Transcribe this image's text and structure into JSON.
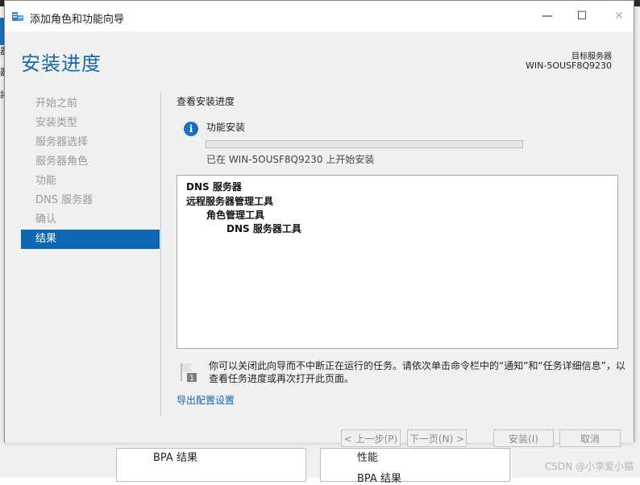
{
  "background": {
    "left_chars": [
      "器",
      "器",
      "諸"
    ],
    "panel_left_text": "BPA 结果",
    "panel_right_text_1": "性能",
    "panel_right_text_2": "BPA 结果",
    "watermark": "CSDN @小李爱小猫"
  },
  "window": {
    "title": "添加角色和功能向导",
    "controls": {
      "minimize": "—",
      "maximize": "☐",
      "close": "✕"
    }
  },
  "header": {
    "page_title": "安装进度",
    "target_label": "目标服务器",
    "target_server": "WIN-5OUSF8Q9230"
  },
  "nav": {
    "items": [
      {
        "label": "开始之前",
        "active": false
      },
      {
        "label": "安装类型",
        "active": false
      },
      {
        "label": "服务器选择",
        "active": false
      },
      {
        "label": "服务器角色",
        "active": false
      },
      {
        "label": "功能",
        "active": false
      },
      {
        "label": "DNS 服务器",
        "active": false
      },
      {
        "label": "确认",
        "active": false
      },
      {
        "label": "结果",
        "active": true
      }
    ]
  },
  "main": {
    "section_title": "查看安装进度",
    "progress": {
      "label": "功能安装",
      "fraction": 0.0,
      "status": "已在 WIN-5OUSF8Q9230 上开始安装"
    },
    "results": [
      {
        "label": "DNS 服务器",
        "level": 0
      },
      {
        "label": "远程服务器管理工具",
        "level": 0
      },
      {
        "label": "角色管理工具",
        "level": 1
      },
      {
        "label": "DNS 服务器工具",
        "level": 2
      }
    ],
    "notice_text": "你可以关闭此向导而不中断正在运行的任务。请依次单击命令栏中的“通知”和“任务详细信息”，以查看任务进度或再次打开此页面。",
    "export_link": "导出配置设置"
  },
  "footer": {
    "prev": "< 上一步(P)",
    "next": "下一页(N) >",
    "install": "安装(I)",
    "cancel": "取消"
  },
  "colors": {
    "accent": "#0e67b1",
    "title_blue": "#1b6aa3",
    "progress_green": "#06b025"
  }
}
